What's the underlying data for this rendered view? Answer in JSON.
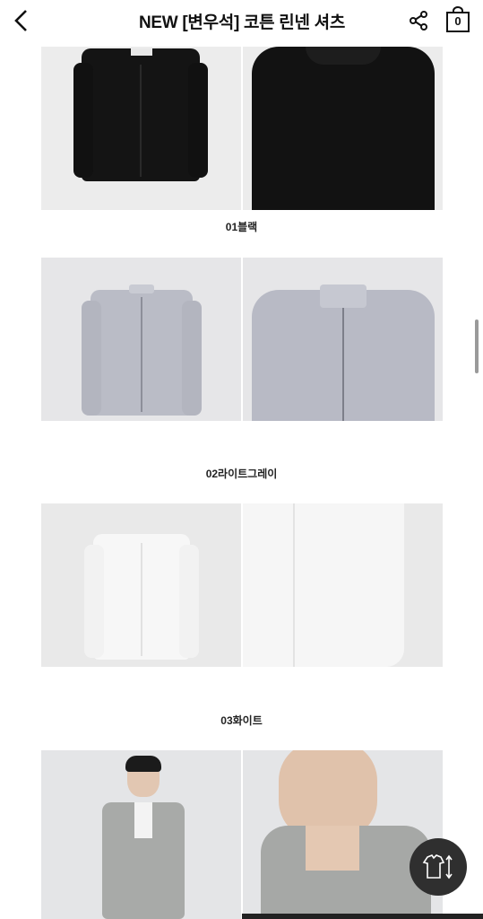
{
  "header": {
    "title": "NEW [변우석] 코튼 린넨 셔츠",
    "cart_count": "0",
    "back_icon": "chevron-left-icon",
    "share_icon": "share-icon",
    "cart_icon": "shopping-bag-icon"
  },
  "colors": [
    {
      "caption": "01블랙",
      "shirt_color": "#151515",
      "bg": "#ececec"
    },
    {
      "caption": "02라이트그레이",
      "shirt_color": "#b9bbc6",
      "bg": "#e6e6e8"
    },
    {
      "caption": "03화이트",
      "shirt_color": "#f6f6f6",
      "bg": "#e9e9e9"
    }
  ],
  "floating": {
    "fit_icon": "shirt-size-icon"
  }
}
